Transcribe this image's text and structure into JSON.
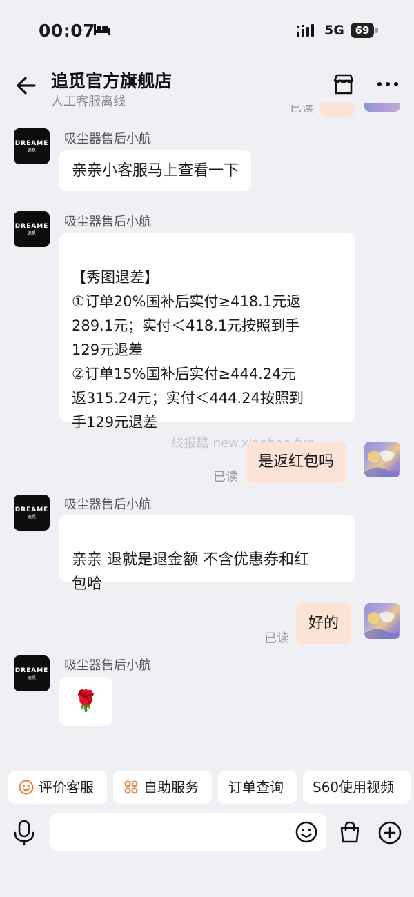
{
  "status_bar": {
    "time": "00:07",
    "network": "5G",
    "battery": "69"
  },
  "header": {
    "title": "追觅官方旗舰店",
    "subtitle": "人工客服离线"
  },
  "top_clipped": {
    "read_label": "已读"
  },
  "brand_avatar": {
    "line1": "DREAME",
    "line2": "追觅"
  },
  "messages": [
    {
      "sender": "吸尘器售后小航",
      "text": "亲亲小客服马上查看一下"
    },
    {
      "sender": "吸尘器售后小航",
      "text": "【秀图退差】\n①订单20%国补后实付≥418.1元返\n 289.1元；实付＜418.1元按照到手\n 129元退差\n②订单15%国补后实付≥444.24元\n返315.24元；实付＜444.24按照到\n手129元退差"
    },
    {
      "text": "是返红包吗",
      "status": "已读"
    },
    {
      "sender": "吸尘器售后小航",
      "text": "亲亲 退就是退金额  不含优惠券和红\n包哈"
    },
    {
      "text": "好的",
      "status": "已读"
    },
    {
      "sender": "吸尘器售后小航",
      "text": "🌹"
    }
  ],
  "watermark": "线报酷-new.xianbao.fun",
  "quick_actions": [
    {
      "label": "评价客服",
      "icon": "smile-icon"
    },
    {
      "label": "自助服务",
      "icon": "grid-dots-icon"
    },
    {
      "label": "订单查询"
    },
    {
      "label": "S60使用视频"
    }
  ],
  "input": {
    "placeholder": ""
  },
  "colors": {
    "background": "#eef0f4",
    "outgoing_bubble": "#fde3d6",
    "incoming_bubble": "#ffffff",
    "icon_accent": "#e07a3a"
  }
}
